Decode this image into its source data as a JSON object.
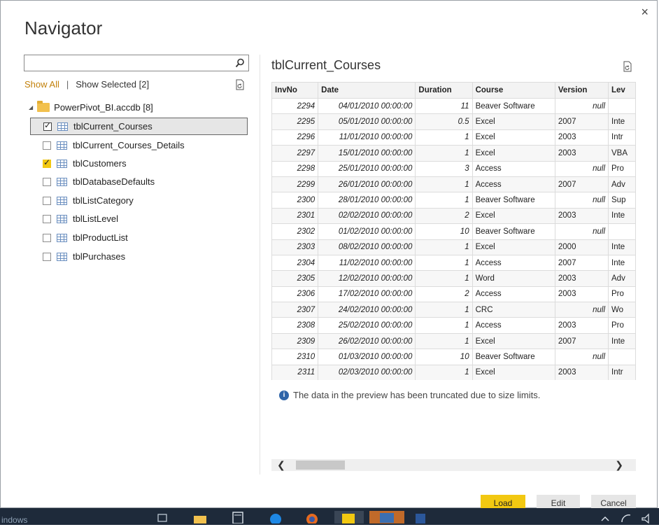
{
  "dialog": {
    "title": "Navigator",
    "close_glyph": "×"
  },
  "left": {
    "search": {
      "value": "",
      "placeholder": ""
    },
    "show_all": "Show All",
    "separator": "|",
    "show_selected": "Show Selected [2]",
    "root": {
      "label": "PowerPivot_BI.accdb [8]"
    },
    "items": [
      {
        "label": "tblCurrent_Courses",
        "checked": true,
        "selected": true
      },
      {
        "label": "tblCurrent_Courses_Details",
        "checked": false,
        "selected": false
      },
      {
        "label": "tblCustomers",
        "checked": true,
        "selected": false
      },
      {
        "label": "tblDatabaseDefaults",
        "checked": false,
        "selected": false
      },
      {
        "label": "tblListCategory",
        "checked": false,
        "selected": false
      },
      {
        "label": "tblListLevel",
        "checked": false,
        "selected": false
      },
      {
        "label": "tblProductList",
        "checked": false,
        "selected": false
      },
      {
        "label": "tblPurchases",
        "checked": false,
        "selected": false
      }
    ]
  },
  "preview": {
    "title": "tblCurrent_Courses",
    "columns": [
      "InvNo",
      "Date",
      "Duration",
      "Course",
      "Version",
      "Lev"
    ],
    "rows": [
      [
        "2294",
        "04/01/2010 00:00:00",
        "11",
        "Beaver Software",
        "null",
        ""
      ],
      [
        "2295",
        "05/01/2010 00:00:00",
        "0.5",
        "Excel",
        "2007",
        "Inte"
      ],
      [
        "2296",
        "11/01/2010 00:00:00",
        "1",
        "Excel",
        "2003",
        "Intr"
      ],
      [
        "2297",
        "15/01/2010 00:00:00",
        "1",
        "Excel",
        "2003",
        "VBA"
      ],
      [
        "2298",
        "25/01/2010 00:00:00",
        "3",
        "Access",
        "null",
        "Pro"
      ],
      [
        "2299",
        "26/01/2010 00:00:00",
        "1",
        "Access",
        "2007",
        "Adv"
      ],
      [
        "2300",
        "28/01/2010 00:00:00",
        "1",
        "Beaver Software",
        "null",
        "Sup"
      ],
      [
        "2301",
        "02/02/2010 00:00:00",
        "2",
        "Excel",
        "2003",
        "Inte"
      ],
      [
        "2302",
        "01/02/2010 00:00:00",
        "10",
        "Beaver Software",
        "null",
        ""
      ],
      [
        "2303",
        "08/02/2010 00:00:00",
        "1",
        "Excel",
        "2000",
        "Inte"
      ],
      [
        "2304",
        "11/02/2010 00:00:00",
        "1",
        "Access",
        "2007",
        "Inte"
      ],
      [
        "2305",
        "12/02/2010 00:00:00",
        "1",
        "Word",
        "2003",
        "Adv"
      ],
      [
        "2306",
        "17/02/2010 00:00:00",
        "2",
        "Access",
        "2003",
        "Pro"
      ],
      [
        "2307",
        "24/02/2010 00:00:00",
        "1",
        "CRC",
        "null",
        "Wo"
      ],
      [
        "2308",
        "25/02/2010 00:00:00",
        "1",
        "Access",
        "2003",
        "Pro"
      ],
      [
        "2309",
        "26/02/2010 00:00:00",
        "1",
        "Excel",
        "2007",
        "Inte"
      ],
      [
        "2310",
        "01/03/2010 00:00:00",
        "10",
        "Beaver Software",
        "null",
        ""
      ],
      [
        "2311",
        "02/03/2010 00:00:00",
        "1",
        "Excel",
        "2003",
        "Intr"
      ]
    ],
    "truncation_note": "The data in the preview has been truncated due to size limits.",
    "scroll_left": "❮",
    "scroll_right": "❯"
  },
  "buttons": {
    "load": "Load",
    "edit": "Edit",
    "cancel": "Cancel"
  },
  "taskbar": {
    "text": "indows"
  },
  "colors": {
    "accent": "#f2c811",
    "link": "#c2810b",
    "taskbar": "#1e2a3a"
  }
}
